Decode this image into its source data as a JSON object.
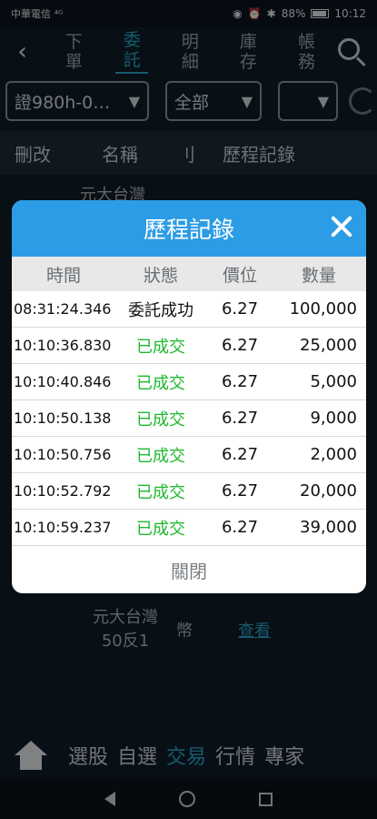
{
  "status_bar": {
    "carrier": "中華電信 ⁴ᴳ",
    "battery": "88%",
    "time": "10:12"
  },
  "nav": {
    "tabs": [
      {
        "label": "下\n單",
        "active": false
      },
      {
        "label": "委\n託",
        "active": true
      },
      {
        "label": "明\n細",
        "active": false
      },
      {
        "label": "庫\n存",
        "active": false
      },
      {
        "label": "帳\n務",
        "active": false
      }
    ]
  },
  "filters": {
    "account": "證980h-0…",
    "scope": "全部",
    "third": ""
  },
  "table_header": {
    "edit": "刪改",
    "name": "名稱",
    "divider": "刂",
    "history": "歷程記錄"
  },
  "background_rows": {
    "row1_name": "元大台灣",
    "row2_name": "元大台灣\n50反1",
    "row2_currency": "幣",
    "row2_link": "查看"
  },
  "modal": {
    "title": "歷程記錄",
    "columns": [
      "時間",
      "狀態",
      "價位",
      "數量"
    ],
    "rows": [
      {
        "time": "08:31:24.346",
        "status": "委託成功",
        "price": "6.27",
        "qty": "100,000",
        "kind": "sent"
      },
      {
        "time": "10:10:36.830",
        "status": "已成交",
        "price": "6.27",
        "qty": "25,000",
        "kind": "ok"
      },
      {
        "time": "10:10:40.846",
        "status": "已成交",
        "price": "6.27",
        "qty": "5,000",
        "kind": "ok"
      },
      {
        "time": "10:10:50.138",
        "status": "已成交",
        "price": "6.27",
        "qty": "9,000",
        "kind": "ok"
      },
      {
        "time": "10:10:50.756",
        "status": "已成交",
        "price": "6.27",
        "qty": "2,000",
        "kind": "ok"
      },
      {
        "time": "10:10:52.792",
        "status": "已成交",
        "price": "6.27",
        "qty": "20,000",
        "kind": "ok"
      },
      {
        "time": "10:10:59.237",
        "status": "已成交",
        "price": "6.27",
        "qty": "39,000",
        "kind": "ok"
      }
    ],
    "close_label": "關閉"
  },
  "bottom_nav": {
    "items": [
      {
        "label": "選股",
        "active": false
      },
      {
        "label": "自選",
        "active": false
      },
      {
        "label": "交易",
        "active": true
      },
      {
        "label": "行情",
        "active": false
      },
      {
        "label": "專家",
        "active": false
      }
    ]
  },
  "colors": {
    "accent": "#2aa6c9",
    "modal_header": "#2c9ce6",
    "filled_green": "#1eb82e"
  }
}
